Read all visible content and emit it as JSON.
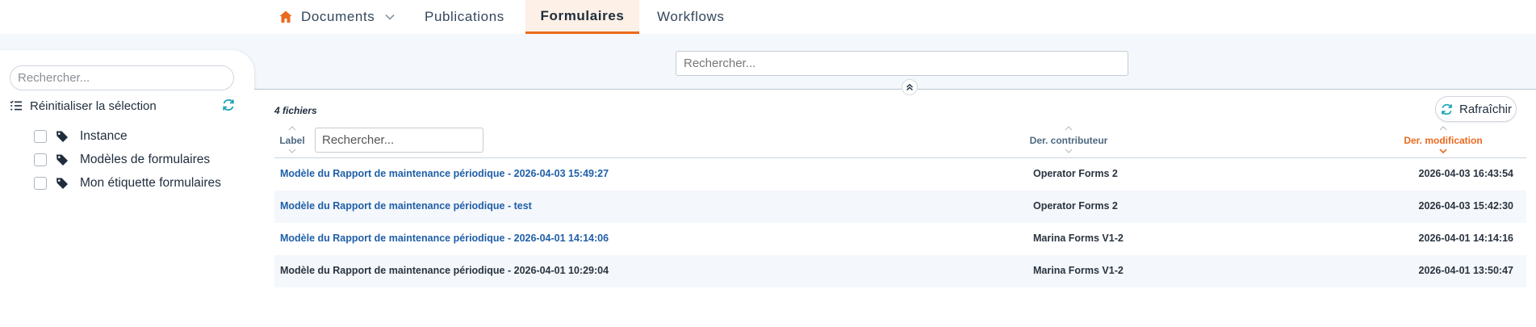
{
  "nav": {
    "tabs": [
      {
        "label": "Documents",
        "icon": "home-icon",
        "has_dropdown": true
      },
      {
        "label": "Publications"
      },
      {
        "label": "Formulaires",
        "active": true
      },
      {
        "label": "Workflows"
      }
    ],
    "active_color": "#ea6a1f"
  },
  "sidebar": {
    "search_placeholder": "Rechercher...",
    "reset_label": "Réinitialiser la sélection",
    "tags": [
      {
        "label": "Instance",
        "checked": false
      },
      {
        "label": "Modèles de formulaires",
        "checked": false
      },
      {
        "label": "Mon étiquette formulaires",
        "checked": false
      }
    ]
  },
  "main": {
    "search_placeholder": "Rechercher...",
    "file_count": "4 fichiers",
    "refresh_label": "Rafraîchir",
    "columns": {
      "label": "Label",
      "label_search_placeholder": "Rechercher...",
      "contributor": "Der. contributeur",
      "modified": "Der. modification",
      "sorted_column": "modified",
      "sort_direction": "descending"
    },
    "rows": [
      {
        "label": "Modèle du Rapport de maintenance périodique - 2026-04-03 15:49:27",
        "contributor": "Operator Forms 2",
        "modified": "2026-04-03 16:43:54",
        "link": true
      },
      {
        "label": "Modèle du Rapport de maintenance périodique - test",
        "contributor": "Operator Forms 2",
        "modified": "2026-04-03 15:42:30",
        "link": true
      },
      {
        "label": "Modèle du Rapport de maintenance périodique - 2026-04-01 14:14:06",
        "contributor": "Marina Forms V1-2",
        "modified": "2026-04-01 14:14:16",
        "link": true
      },
      {
        "label": "Modèle du Rapport de maintenance périodique - 2026-04-01 10:29:04",
        "contributor": "Marina Forms V1-2",
        "modified": "2026-04-01 13:50:47",
        "link": false
      }
    ]
  }
}
